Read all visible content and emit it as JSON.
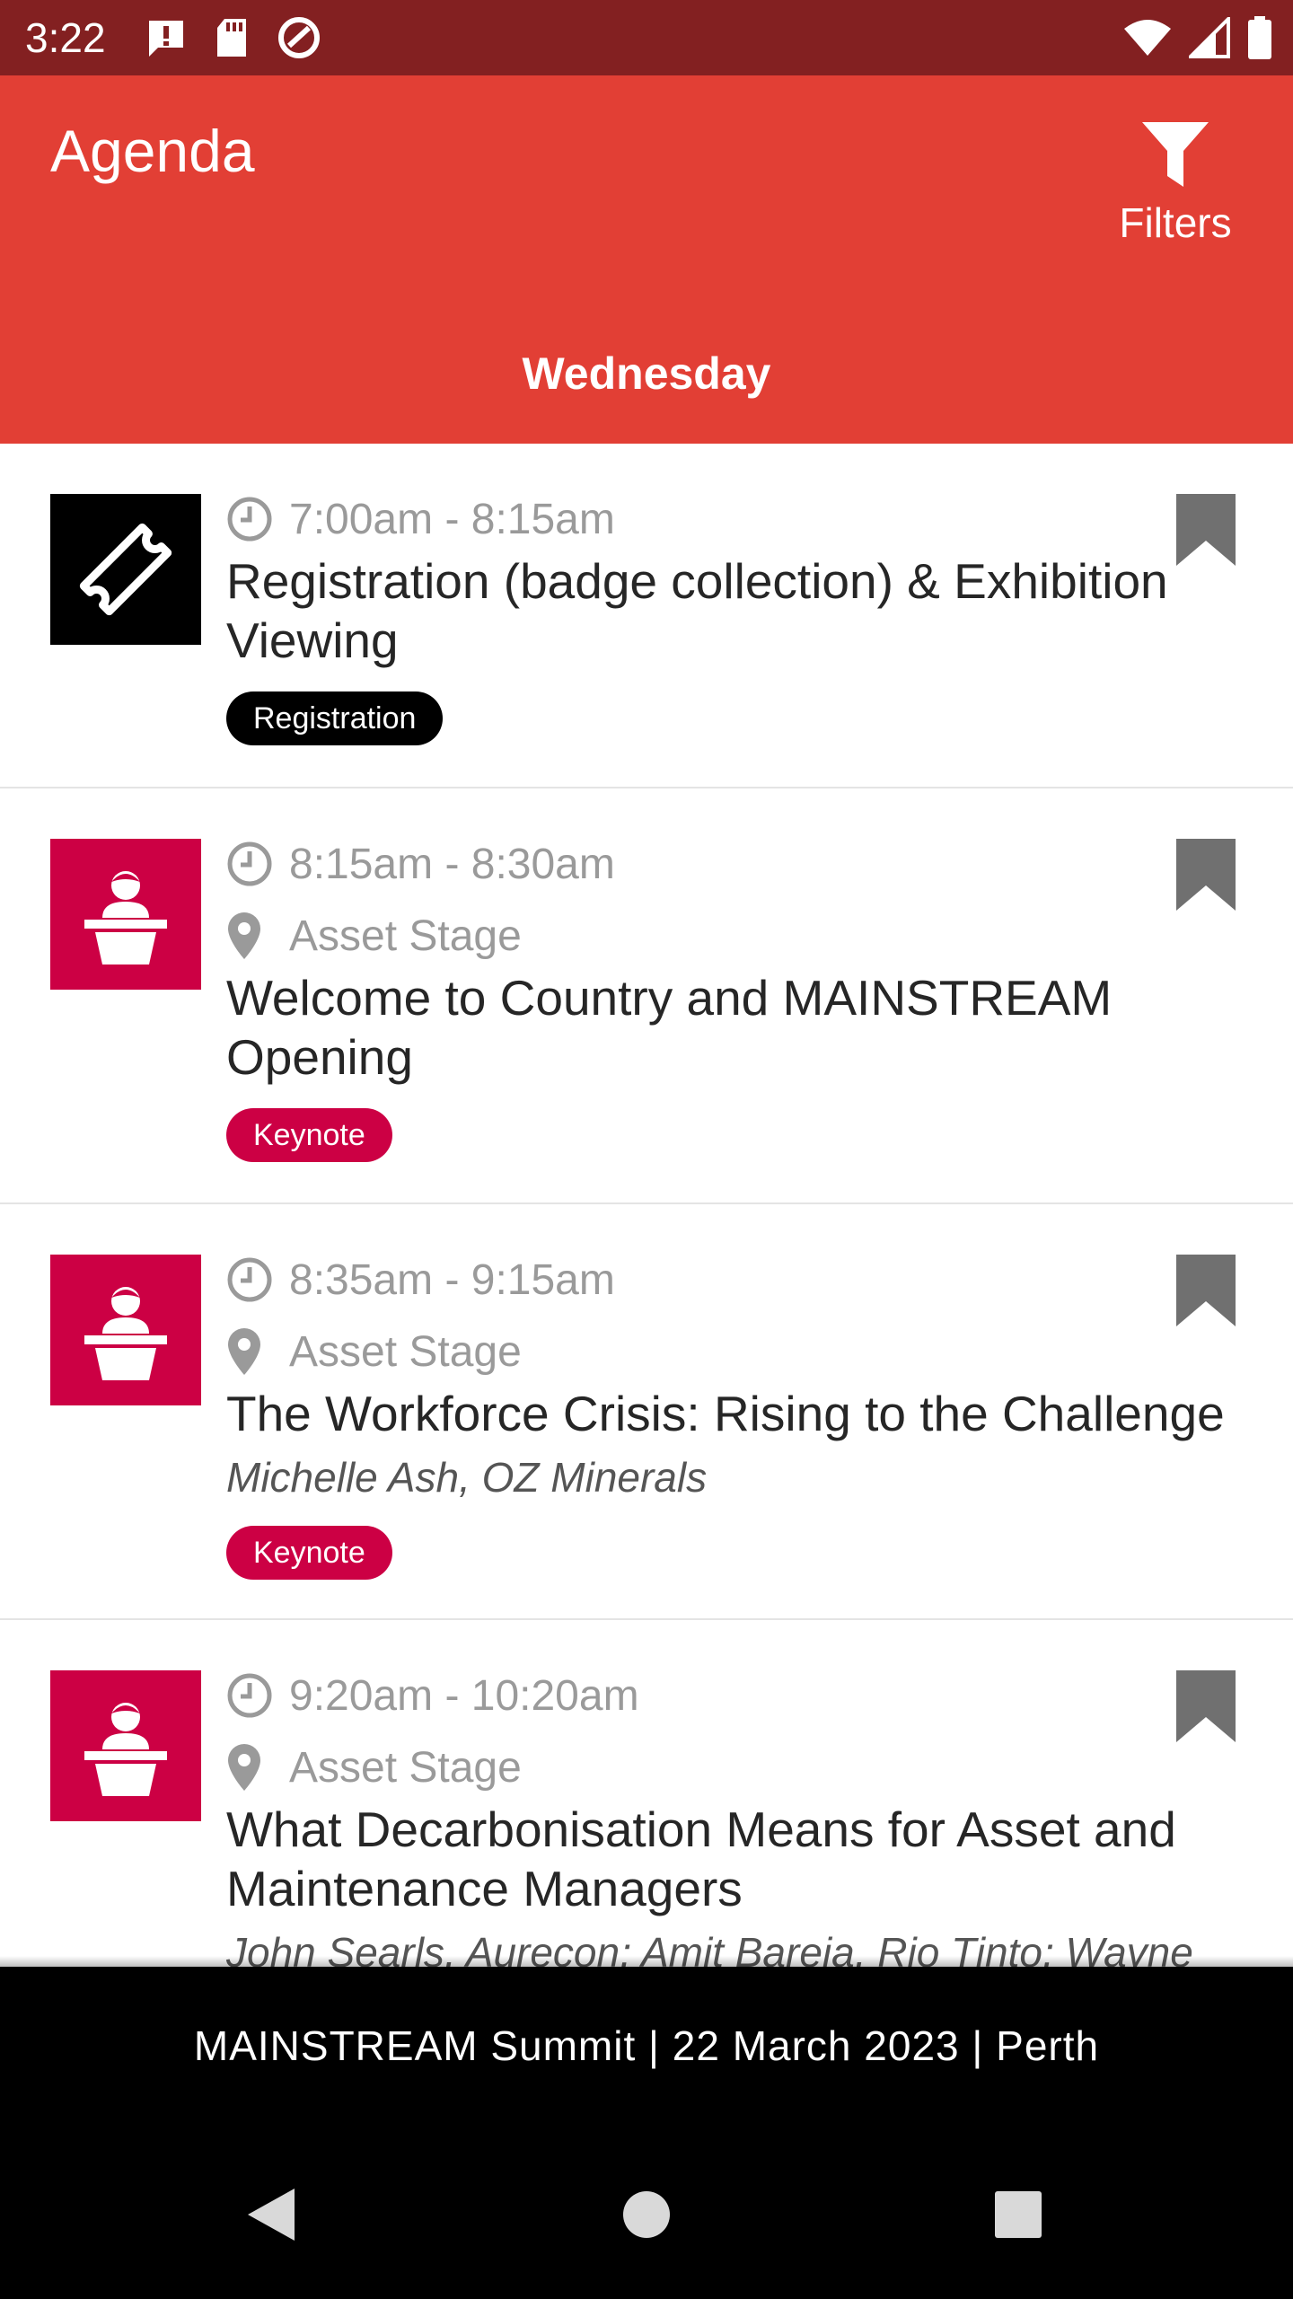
{
  "status_bar": {
    "time": "3:22"
  },
  "app_bar": {
    "title": "Agenda",
    "filters_label": "Filters",
    "day": "Wednesday",
    "background": "#e23f35"
  },
  "sessions": [
    {
      "time": "7:00am - 8:15am",
      "location": "",
      "title": "Registration (badge collection) & Exhibition Viewing",
      "speakers": "",
      "tag": "Registration",
      "thumb_icon": "ticket-icon",
      "color": "#000000"
    },
    {
      "time": "8:15am - 8:30am",
      "location": "Asset Stage",
      "title": "Welcome to Country and MAINSTREAM Opening",
      "speakers": "",
      "tag": "Keynote",
      "thumb_icon": "speaker-podium-icon",
      "color": "#cc0044"
    },
    {
      "time": "8:35am - 9:15am",
      "location": "Asset Stage",
      "title": "The Workforce Crisis: Rising to the Challenge",
      "speakers": "Michelle Ash, OZ Minerals",
      "tag": "Keynote",
      "thumb_icon": "speaker-podium-icon",
      "color": "#cc0044"
    },
    {
      "time": "9:20am - 10:20am",
      "location": "Asset Stage",
      "title": "What Decarbonisation Means for Asset and Maintenance Managers",
      "speakers": "John Searls, Aurecon; Amit Bareja, Rio Tinto; Wayne",
      "tag": "",
      "thumb_icon": "speaker-podium-icon",
      "color": "#cc0044"
    }
  ],
  "footer": {
    "banner": "MAINSTREAM Summit | 22 March 2023 | Perth"
  }
}
